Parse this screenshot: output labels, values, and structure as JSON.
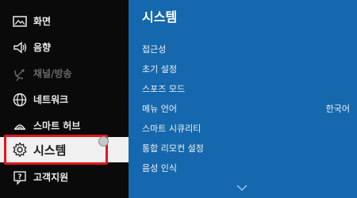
{
  "sidebar": {
    "items": [
      {
        "label": "화면",
        "icon": "picture-icon"
      },
      {
        "label": "음향",
        "icon": "speaker-icon"
      },
      {
        "label": "채널/방송",
        "icon": "satellite-dish-icon"
      },
      {
        "label": "네트워크",
        "icon": "globe-icon"
      },
      {
        "label": "스마트 허브",
        "icon": "smart-hub-icon"
      },
      {
        "label": "시스템",
        "icon": "gear-icon"
      },
      {
        "label": "고객지원",
        "icon": "support-icon"
      }
    ],
    "selected_index": 5
  },
  "panel": {
    "title": "시스템",
    "items": [
      {
        "label": "접근성",
        "value": ""
      },
      {
        "label": "초기 설정",
        "value": ""
      },
      {
        "label": "스포즈 모드",
        "value": ""
      },
      {
        "label": "메뉴 언어",
        "value": "한국어"
      },
      {
        "label": "스마트 시큐리티",
        "value": ""
      },
      {
        "label": "통합 리모컨 설정",
        "value": ""
      },
      {
        "label": "음성 인식",
        "value": ""
      }
    ]
  },
  "colors": {
    "panel_background": "#1568ad",
    "sidebar_background": "#0a0a0a",
    "highlight_border": "#e0161b"
  }
}
